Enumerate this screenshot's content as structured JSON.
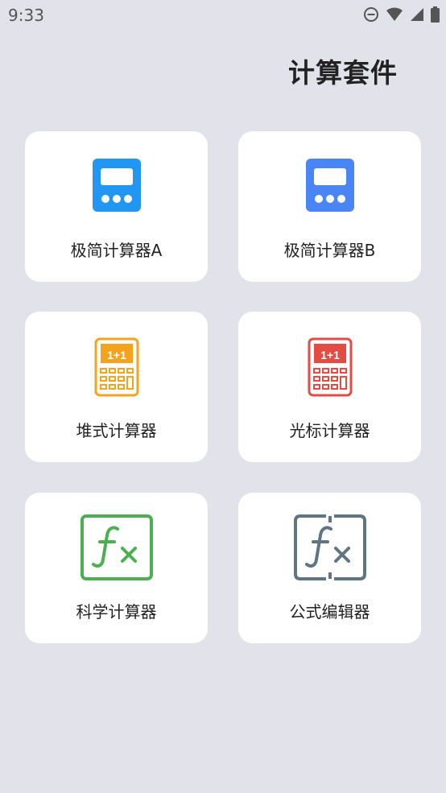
{
  "status_bar": {
    "time": "9:33",
    "icons": [
      "do-not-disturb-icon",
      "wifi-icon",
      "cellular-signal-icon",
      "battery-icon"
    ]
  },
  "header": {
    "title": "计算套件"
  },
  "apps": [
    {
      "label": "极简计算器A",
      "icon": "simple-calculator-icon",
      "color": "#2196f3"
    },
    {
      "label": "极简计算器B",
      "icon": "simple-calculator-icon",
      "color": "#4a85f6"
    },
    {
      "label": "堆式计算器",
      "icon": "keypad-calculator-icon",
      "color": "#f5a31c",
      "display_text": "1+1"
    },
    {
      "label": "光标计算器",
      "icon": "keypad-calculator-icon",
      "color": "#e44c43",
      "display_text": "1+1"
    },
    {
      "label": "科学计算器",
      "icon": "function-fx-icon",
      "color": "#4caf50"
    },
    {
      "label": "公式编辑器",
      "icon": "function-fx-dashed-icon",
      "color": "#5f7682"
    }
  ],
  "colors": {
    "background": "#e1e2ea",
    "card": "#ffffff"
  }
}
